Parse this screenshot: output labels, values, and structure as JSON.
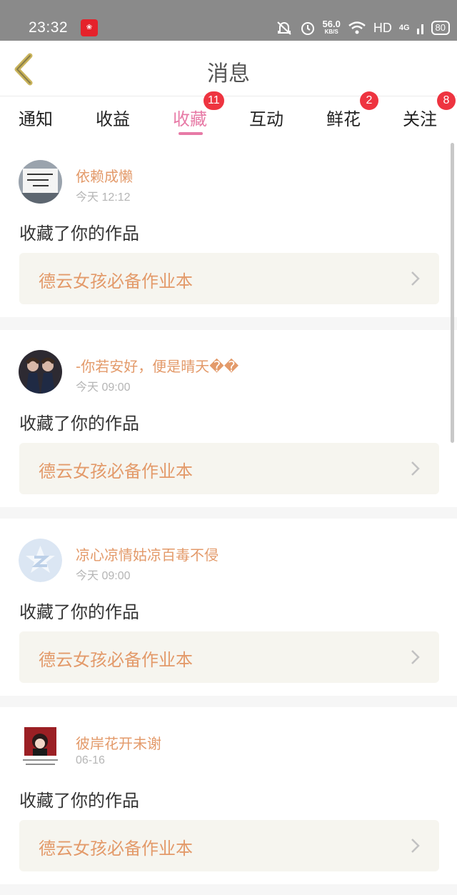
{
  "status_bar": {
    "time": "23:32",
    "app_icon": "weibo-like-app-icon",
    "speed_value": "56.0",
    "speed_unit": "KB/S",
    "network": "HD",
    "signal": "4G",
    "battery": "80"
  },
  "header": {
    "title": "消息",
    "back_icon": "chevron-left-icon"
  },
  "tabs": [
    {
      "label": "通知",
      "badge": ""
    },
    {
      "label": "收益",
      "badge": ""
    },
    {
      "label": "收藏",
      "badge": "11",
      "active": true
    },
    {
      "label": "互动",
      "badge": ""
    },
    {
      "label": "鲜花",
      "badge": "2"
    },
    {
      "label": "关注",
      "badge": "8"
    }
  ],
  "colors": {
    "accent": "#e77aa6",
    "name": "#e39a6a",
    "badge": "#ee3440",
    "work_bg": "#f6f5ef"
  },
  "feed": [
    {
      "username": "依赖成懒",
      "time": "今天 12:12",
      "action": "收藏了你的作品",
      "work": "德云女孩必备作业本",
      "avatar_icon": "sign-photo-avatar"
    },
    {
      "username": "-你若安好，便是晴天��",
      "time": "今天 09:00",
      "action": "收藏了你的作品",
      "work": "德云女孩必备作业本",
      "avatar_icon": "two-girls-photo-avatar"
    },
    {
      "username": "凉心凉情姑凉百毒不侵",
      "time": "今天 09:00",
      "action": "收藏了你的作品",
      "work": "德云女孩必备作业本",
      "avatar_icon": "default-z-avatar"
    },
    {
      "username": "彼岸花开未谢",
      "time": "06-16",
      "action": "收藏了你的作品",
      "work": "德云女孩必备作业本",
      "avatar_icon": "anime-girl-avatar"
    }
  ]
}
